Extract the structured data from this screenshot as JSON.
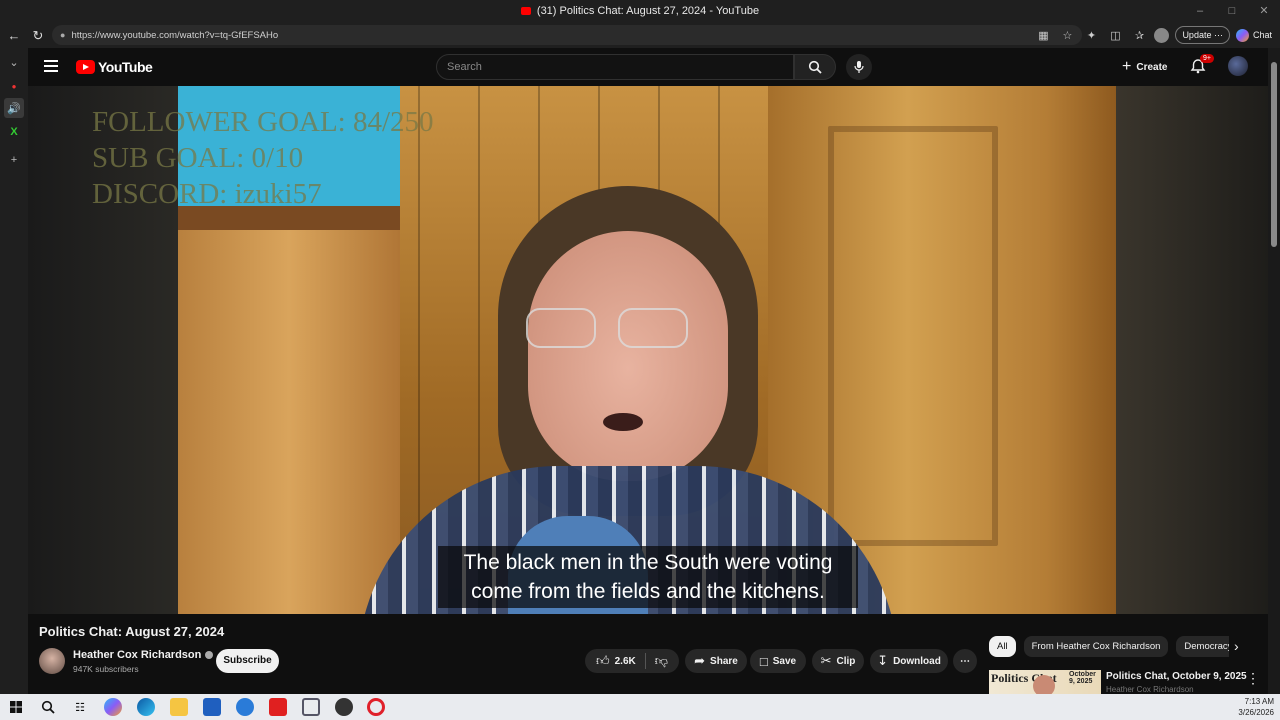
{
  "browser": {
    "tab_title": "(31) Politics Chat: August 27, 2024 - YouTube",
    "url": "https://www.youtube.com/watch?v=tq-GfEFSAHo",
    "update_label": "Update",
    "chat_label": "Chat"
  },
  "youtube": {
    "logo_text": "YouTube",
    "search_placeholder": "Search",
    "create_label": "Create",
    "notification_badge": "9+"
  },
  "video": {
    "overlay_lines": [
      "FOLLOWER GOAL:  84/250",
      "SUB GOAL: 0/10",
      "DISCORD: izuki57"
    ],
    "caption_lines": [
      "The black men in the South were voting",
      "come from the fields and the kitchens."
    ],
    "title": "Politics Chat: August 27, 2024"
  },
  "channel": {
    "name": "Heather Cox Richardson",
    "subscribers": "947K subscribers",
    "subscribe_label": "Subscribe"
  },
  "actions": {
    "likes": "2.6K",
    "share": "Share",
    "save": "Save",
    "clip": "Clip",
    "download": "Download"
  },
  "chips": [
    "All",
    "From Heather Cox Richardson",
    "Democracy"
  ],
  "recommended": {
    "thumb_text": "Politics Chat",
    "thumb_date": "October 9, 2025",
    "title": "Politics Chat, October 9, 2025",
    "channel": "Heather Cox Richardson"
  },
  "system": {
    "time": "7:13 AM",
    "date": "3/26/2026"
  },
  "colors": {
    "youtube_red": "#ff0000",
    "background": "#0f0f0f",
    "chip_bg": "#272727"
  }
}
